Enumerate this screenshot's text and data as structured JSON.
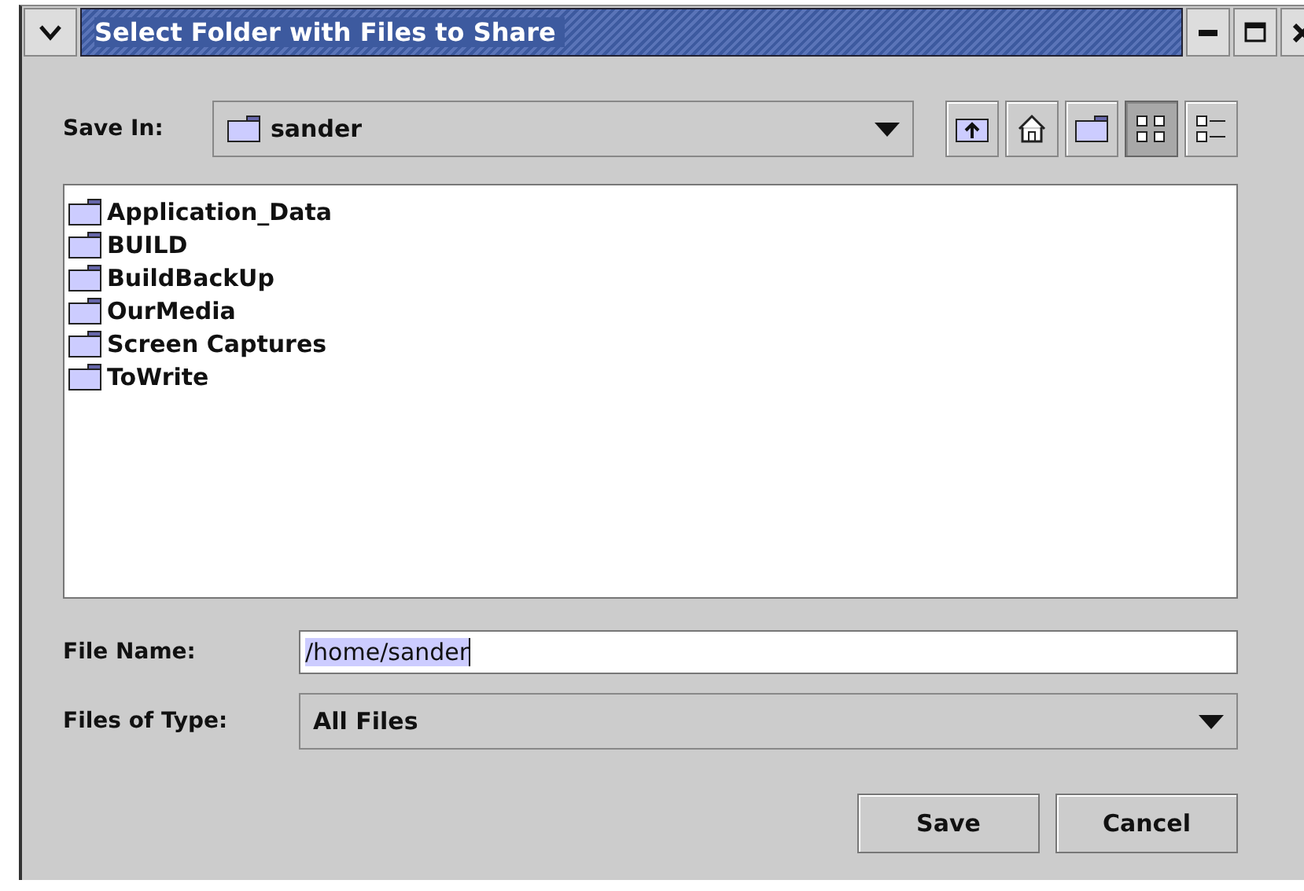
{
  "window": {
    "title": "Select Folder with Files to Share"
  },
  "save_in": {
    "label": "Save In:",
    "value": "sander"
  },
  "toolbar": [
    {
      "kind": "up",
      "selected": false
    },
    {
      "kind": "home",
      "selected": false
    },
    {
      "kind": "new-folder",
      "selected": false
    },
    {
      "kind": "list",
      "selected": true
    },
    {
      "kind": "details",
      "selected": false
    }
  ],
  "files": [
    {
      "name": "Application_Data"
    },
    {
      "name": "BUILD"
    },
    {
      "name": "BuildBackUp"
    },
    {
      "name": "OurMedia"
    },
    {
      "name": "Screen Captures"
    },
    {
      "name": "ToWrite"
    }
  ],
  "file_name": {
    "label": "File Name:",
    "value": "/home/sander",
    "text_selected": true
  },
  "file_type": {
    "label": "Files of Type:",
    "value": "All Files"
  },
  "buttons": [
    "Save",
    "Cancel"
  ]
}
